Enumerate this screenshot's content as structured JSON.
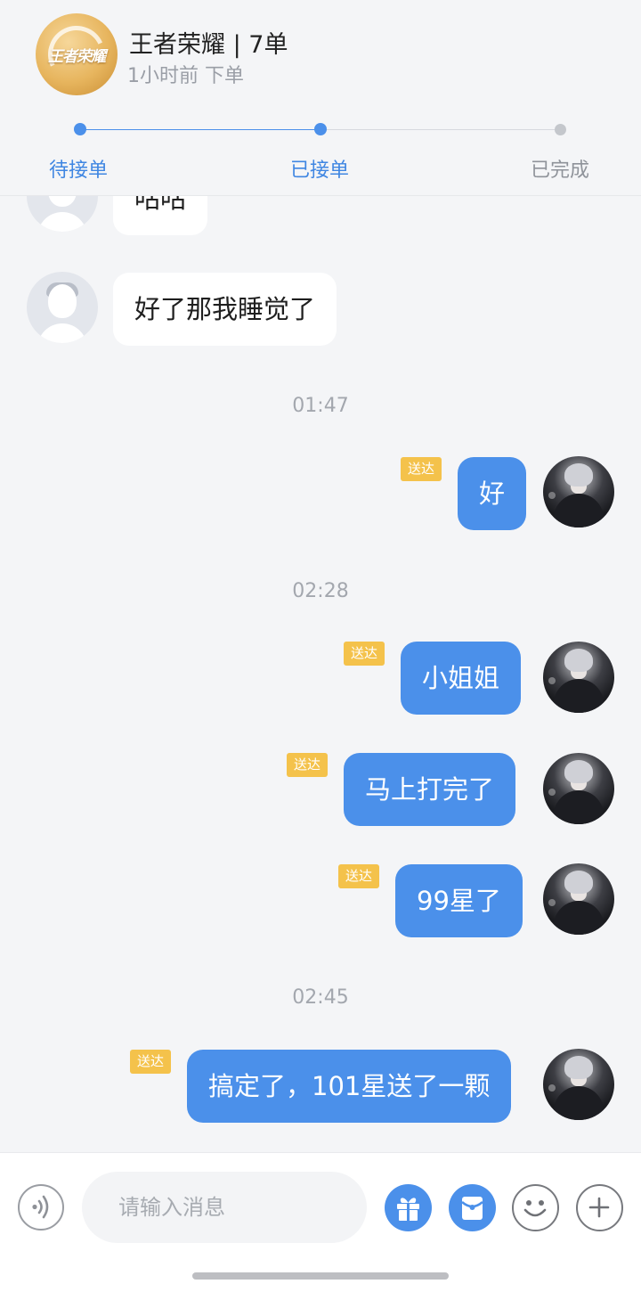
{
  "header": {
    "logo_text": "王者荣耀",
    "order_title": "王者荣耀 | 7单",
    "order_time": "1小时前 下单",
    "steps": [
      "待接单",
      "已接单",
      "已完成"
    ],
    "current_step": 2
  },
  "messages": {
    "partial_in": "咕咕",
    "in_1": "好了那我睡觉了",
    "time_1": "01:47",
    "out_1": "好",
    "time_2": "02:28",
    "out_2": "小姐姐",
    "out_3": "马上打完了",
    "out_4": "99星了",
    "time_3": "02:45",
    "out_5": "搞定了，101星送了一颗",
    "status_delivered": "送达"
  },
  "input_bar": {
    "placeholder": "请输入消息",
    "icons": [
      "voice-icon",
      "gift-icon",
      "red-packet-icon",
      "emoji-icon",
      "plus-icon"
    ]
  },
  "colors": {
    "accent": "#4b90ea",
    "badge": "#f4c24b",
    "background": "#f4f5f7"
  }
}
